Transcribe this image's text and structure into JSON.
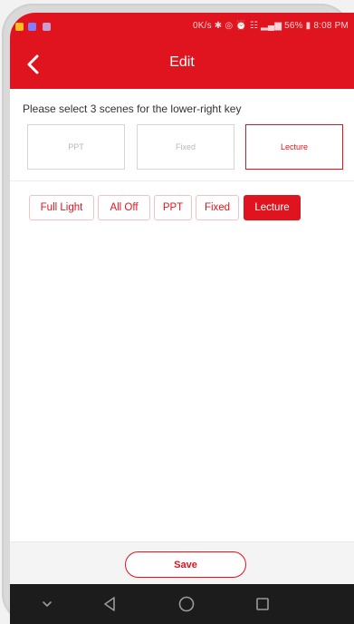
{
  "status_bar": {
    "right_text": "0K/s ✱ ◎ ⏰ ☷ ▂▄▆ 56% ▮ 8:08 PM"
  },
  "header": {
    "title": "Edit"
  },
  "instruction": "Please select 3 scenes for the lower-right key",
  "slots": [
    {
      "label": "PPT"
    },
    {
      "label": "Fixed"
    },
    {
      "label": "Lecture"
    }
  ],
  "scene_options": [
    {
      "label": "Full Light"
    },
    {
      "label": "All Off"
    },
    {
      "label": "PPT"
    },
    {
      "label": "Fixed"
    },
    {
      "label": "Lecture"
    }
  ],
  "footer": {
    "save_label": "Save"
  },
  "colors": {
    "accent": "#e0141e"
  }
}
